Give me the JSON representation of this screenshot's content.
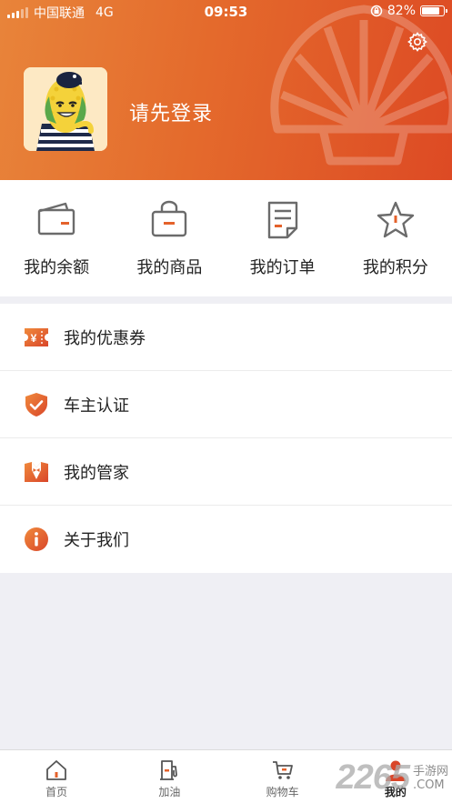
{
  "status_bar": {
    "carrier": "中国联通",
    "network": "4G",
    "time": "09:53",
    "battery": "82%",
    "battery_level": 0.82
  },
  "header": {
    "login_prompt": "请先登录",
    "settings_icon": "gear-icon",
    "avatar": "corn-mascot-avatar",
    "background_mark": "shell-logo"
  },
  "grid": [
    {
      "label": "我的余额",
      "icon": "wallet-icon"
    },
    {
      "label": "我的商品",
      "icon": "shopping-bag-icon"
    },
    {
      "label": "我的订单",
      "icon": "order-document-icon"
    },
    {
      "label": "我的积分",
      "icon": "star-icon"
    }
  ],
  "menu": [
    {
      "label": "我的优惠券",
      "icon": "coupon-icon"
    },
    {
      "label": "车主认证",
      "icon": "shield-check-icon"
    },
    {
      "label": "我的管家",
      "icon": "butler-icon"
    },
    {
      "label": "关于我们",
      "icon": "info-icon"
    }
  ],
  "tabs": [
    {
      "label": "首页",
      "icon": "home-icon"
    },
    {
      "label": "加油",
      "icon": "fuel-pump-icon"
    },
    {
      "label": "购物车",
      "icon": "cart-icon"
    },
    {
      "label": "我的",
      "icon": "profile-icon",
      "active": true
    }
  ],
  "watermark": {
    "number": "2265",
    "text": "手游网",
    "domain": ".COM"
  },
  "colors": {
    "accent": "#e4622b",
    "header_start": "#e8843a",
    "header_end": "#dd4a24",
    "icon_gray": "#6b6b6b"
  }
}
